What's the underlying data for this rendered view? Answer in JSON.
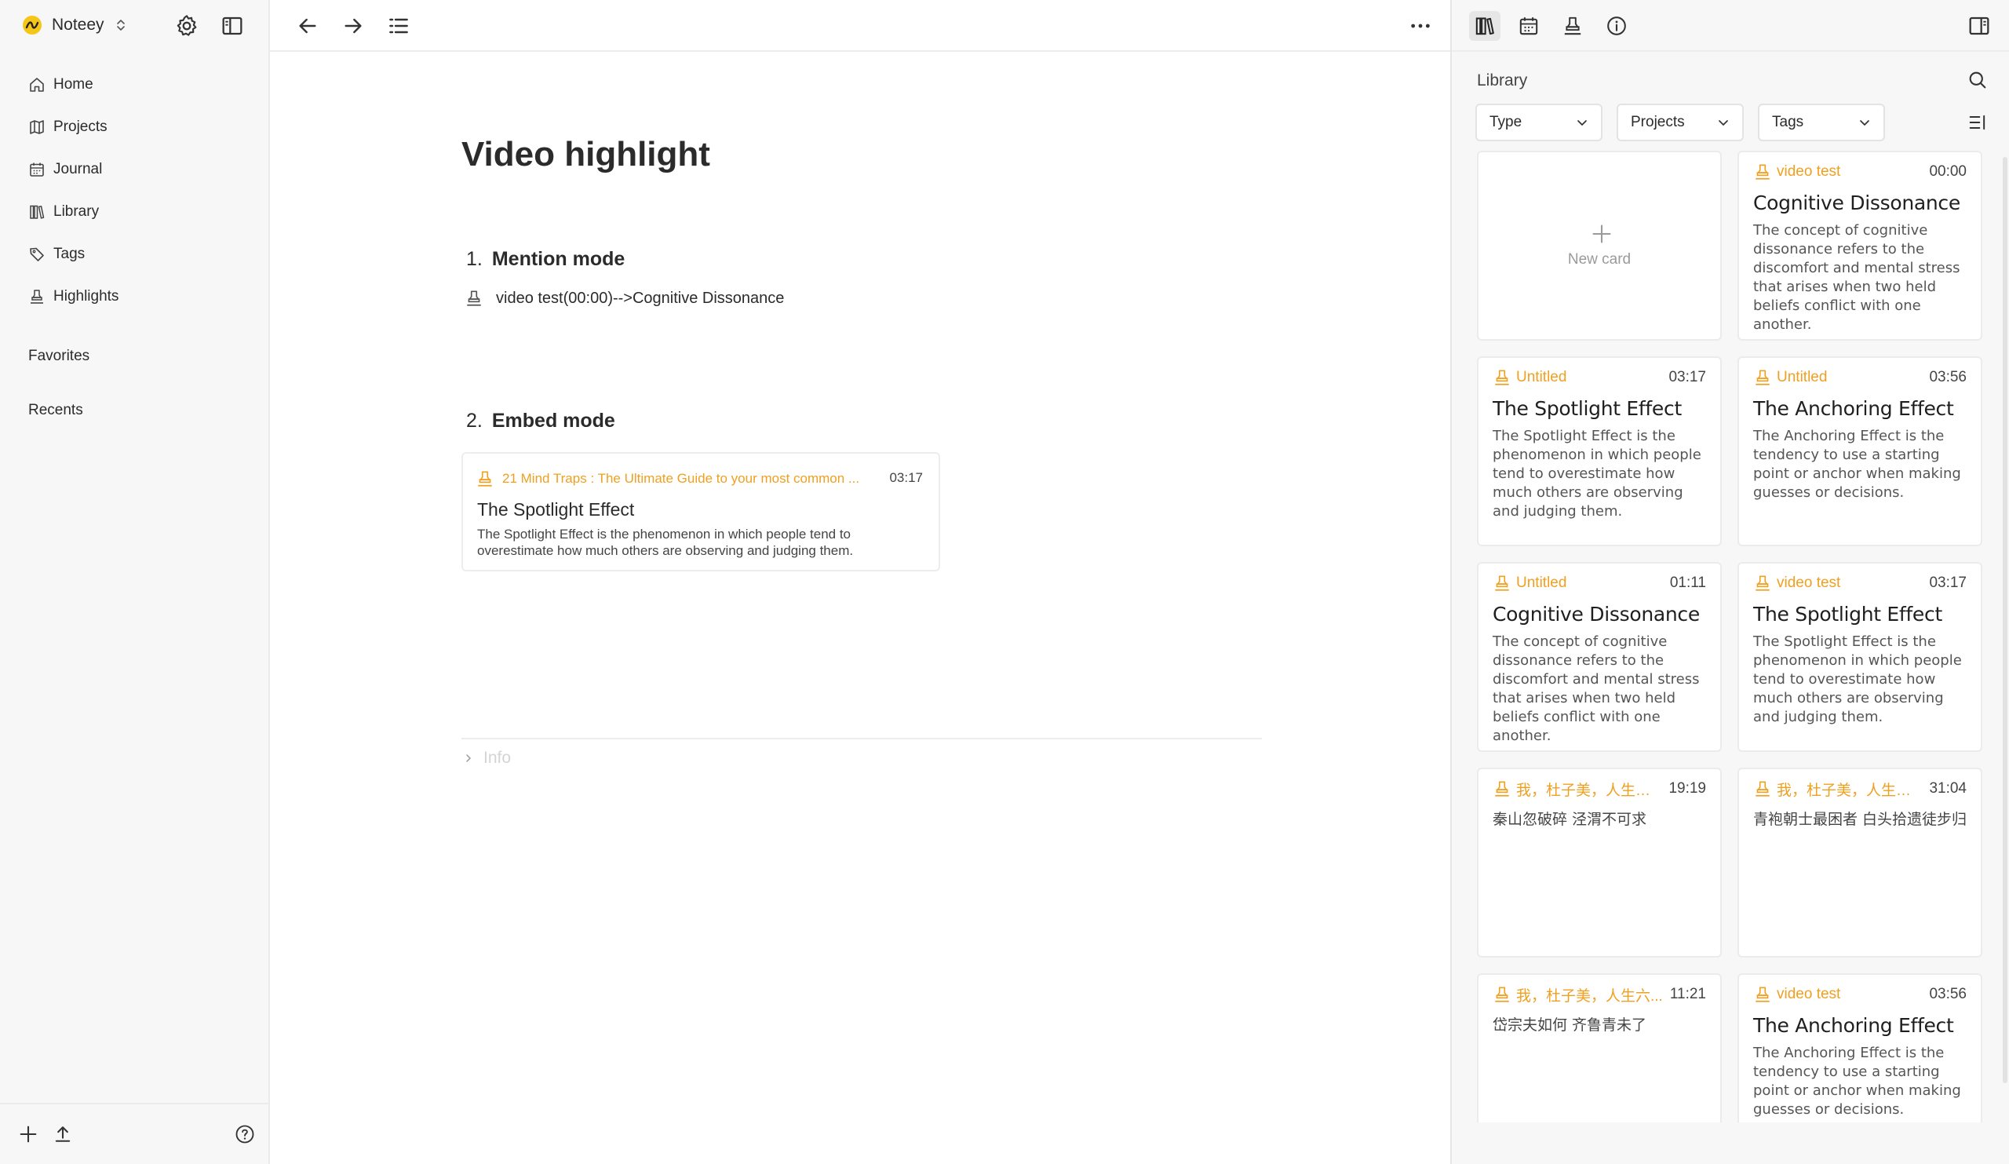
{
  "app": {
    "name": "Noteey"
  },
  "sidebar": {
    "items": [
      {
        "label": "Home",
        "icon": "home-icon"
      },
      {
        "label": "Projects",
        "icon": "map-icon"
      },
      {
        "label": "Journal",
        "icon": "calendar-icon"
      },
      {
        "label": "Library",
        "icon": "library-icon"
      },
      {
        "label": "Tags",
        "icon": "tag-icon"
      },
      {
        "label": "Highlights",
        "icon": "highlighter-icon"
      }
    ],
    "favorites_label": "Favorites",
    "recents_label": "Recents"
  },
  "document": {
    "title": "Video highlight",
    "section1": {
      "number": "1.",
      "title": "Mention mode"
    },
    "mention_text": "video test(00:00)-->Cognitive Dissonance",
    "section2": {
      "number": "2.",
      "title": "Embed mode"
    },
    "embed": {
      "source": "21 Mind Traps : The Ultimate Guide to your most common ...",
      "time": "03:17",
      "title": "The Spotlight Effect",
      "desc": "The Spotlight Effect is the phenomenon in which people tend to overestimate how much others are observing and judging them."
    },
    "info_label": "Info"
  },
  "library": {
    "title": "Library",
    "filters": [
      "Type",
      "Projects",
      "Tags"
    ],
    "new_card_label": "New card",
    "cards": [
      {
        "source": "video test",
        "time": "00:00",
        "title": "Cognitive Dissonance",
        "desc": "The concept of cognitive dissonance refers to the discomfort and mental stress that arises when two held beliefs conflict with one another."
      },
      {
        "source": "Untitled",
        "time": "03:17",
        "title": "The Spotlight Effect",
        "desc": "The Spotlight Effect is the phenomenon in which people tend to overestimate how much others are observing and judging them."
      },
      {
        "source": "Untitled",
        "time": "03:56",
        "title": "The Anchoring Effect",
        "desc": "The Anchoring Effect is the tendency to use a starting point or anchor when making guesses or decisions."
      },
      {
        "source": "Untitled",
        "time": "01:11",
        "title": "Cognitive Dissonance",
        "desc": "The concept of cognitive dissonance refers to the discomfort and mental stress that arises when two held beliefs conflict with one another."
      },
      {
        "source": "video test",
        "time": "03:17",
        "title": "The Spotlight Effect",
        "desc": "The Spotlight Effect is the phenomenon in which people tend to overestimate how much others are observing and judging them."
      },
      {
        "source": "我，杜子美，人生六...",
        "time": "19:19",
        "title": "",
        "desc": "秦山忽破碎 泾渭不可求"
      },
      {
        "source": "我，杜子美，人生六...",
        "time": "31:04",
        "title": "",
        "desc": "青袍朝士最困者 白头拾遗徒步归"
      },
      {
        "source": "我，杜子美，人生六...",
        "time": "11:21",
        "title": "",
        "desc": "岱宗夫如何 齐鲁青未了"
      },
      {
        "source": "video test",
        "time": "03:56",
        "title": "The Anchoring Effect",
        "desc": "The Anchoring Effect is the tendency to use a starting point or anchor when making guesses or decisions."
      }
    ]
  },
  "colors": {
    "accent": "#f0a020",
    "logo": "#f5c518"
  }
}
